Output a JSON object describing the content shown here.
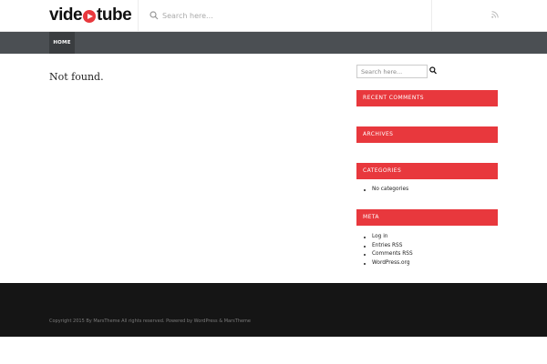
{
  "header": {
    "logo_left": "vide",
    "logo_right": "tube",
    "search_placeholder": "Search here...",
    "rss_icon": "rss-icon"
  },
  "nav": {
    "items": [
      {
        "label": "HOME"
      }
    ]
  },
  "main": {
    "message": "Not found."
  },
  "sidebar": {
    "search_placeholder": "Search here...",
    "widgets": [
      {
        "title": "RECENT COMMENTS",
        "items": []
      },
      {
        "title": "ARCHIVES",
        "items": []
      },
      {
        "title": "CATEGORIES",
        "items": [
          "No categories"
        ]
      },
      {
        "title": "META",
        "items": [
          "Log in",
          "Entries RSS",
          "Comments RSS",
          "WordPress.org"
        ]
      }
    ]
  },
  "footer": {
    "copyright": "Copyright 2015 By MarsTheme All rights reserved. Powered by WordPress & MarsTheme"
  },
  "colors": {
    "accent": "#e8383d",
    "nav": "#4b4f53",
    "footer": "#151515"
  }
}
